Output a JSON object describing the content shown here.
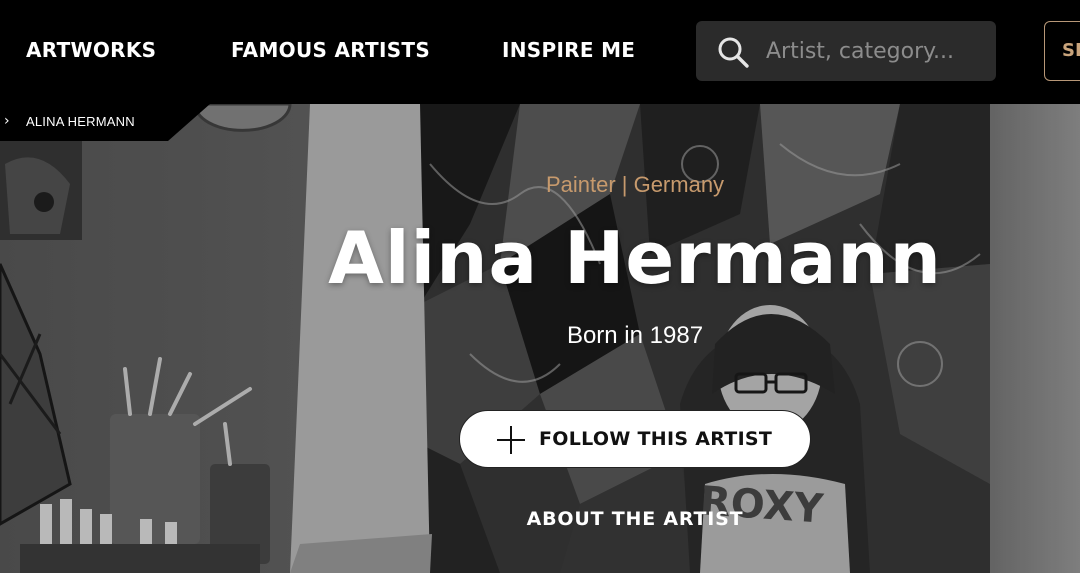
{
  "nav": {
    "items": [
      {
        "label": "ARTWORKS"
      },
      {
        "label": "FAMOUS ARTISTS"
      },
      {
        "label": "INSPIRE ME"
      }
    ],
    "search": {
      "placeholder": "Artist, category..."
    },
    "cta_partial": "SE"
  },
  "breadcrumb": {
    "current": "ALINA HERMANN"
  },
  "hero": {
    "subtitle": "Painter | Germany",
    "name": "Alina Hermann",
    "born": "Born in 1987",
    "follow_label": "FOLLOW THIS ARTIST",
    "about_label": "ABOUT THE ARTIST"
  },
  "colors": {
    "accent": "#c79a6d",
    "nav_bg": "#000000",
    "search_bg": "#2b2b2b"
  }
}
